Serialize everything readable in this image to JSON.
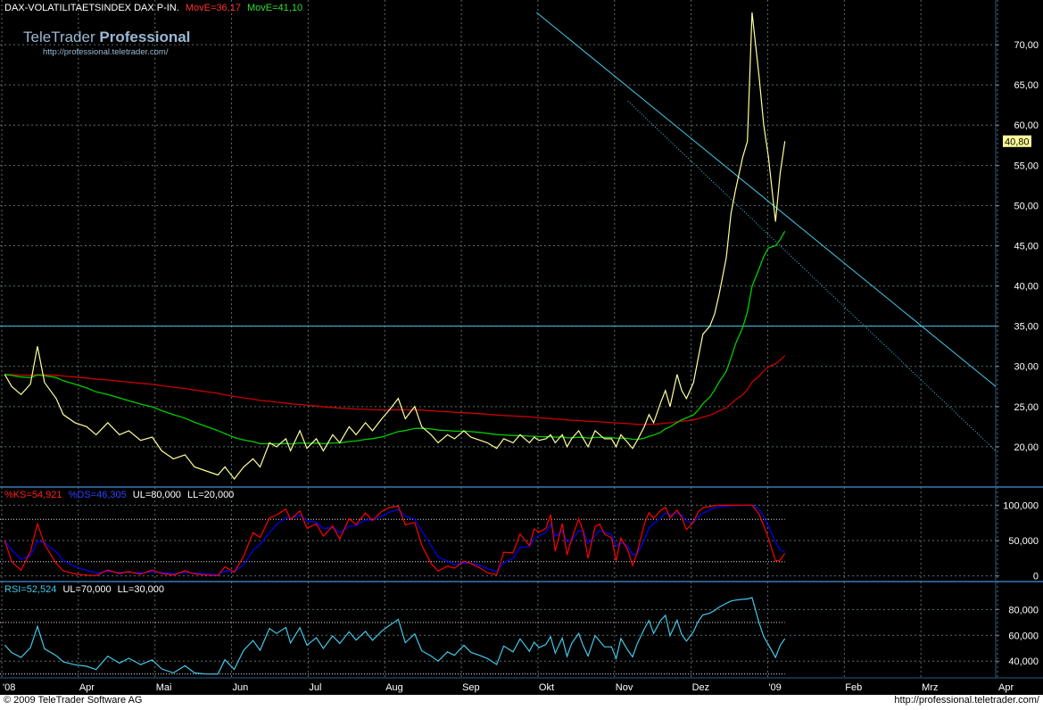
{
  "header": {
    "title": "DAX-VOLATILITAETSINDEX DAX P-IN.",
    "ma_short_label": "MovE=36,17",
    "ma_long_label": "MovE=41,10"
  },
  "watermark": {
    "brand_plain": "TeleTrader ",
    "brand_bold": "Professional",
    "url": "http://professional.teletrader.com/"
  },
  "footer": {
    "copyright": "© 2009 TeleTrader Software AG",
    "url": "http://professional.teletrader.com/"
  },
  "colors": {
    "background": "#000000",
    "price": "#ffff99",
    "ma_long": "#00cc00",
    "ma_short": "#cc0000",
    "trendline": "#44c8e8",
    "stoch_k": "#ff0000",
    "stoch_d": "#0000ff",
    "rsi": "#44c8e8",
    "grid": "#5a6e6e"
  },
  "x_axis": {
    "labels": [
      "'08",
      "Apr",
      "Mai",
      "Jun",
      "Jul",
      "Aug",
      "Sep",
      "Okt",
      "Nov",
      "Dez",
      "'09",
      "Feb",
      "Mrz",
      "Apr"
    ]
  },
  "chart_data": [
    {
      "type": "line",
      "name_text": "DAX-VOLATILITAETSINDEX DAX P-IN.",
      "x_start": "2008-03-01",
      "x_end": "2009-04-30",
      "ylim": [
        15,
        74
      ],
      "yticks": [
        "20,00",
        "25,00",
        "30,00",
        "35,00",
        "40,00",
        "45,00",
        "50,00",
        "55,00",
        "60,00",
        "65,00",
        "70,00"
      ],
      "ytick_values": [
        20,
        25,
        30,
        35,
        40,
        45,
        50,
        55,
        60,
        65,
        70
      ],
      "last_value": "40,80",
      "horizontal_line": 35,
      "trendlines": [
        {
          "style": "solid",
          "from": [
            "2008-10-16",
            74
          ],
          "to": [
            "2009-04-30",
            27.5
          ]
        },
        {
          "style": "dotted",
          "from": [
            "2008-11-24",
            63
          ],
          "to": [
            "2009-04-30",
            19.5
          ]
        }
      ],
      "series": [
        {
          "name": "DAX-VOLATILITAETSINDEX DAX P-IN.",
          "key": "price",
          "points": [
            [
              "2008-03-03",
              29
            ],
            [
              "2008-03-06",
              27.5
            ],
            [
              "2008-03-10",
              26.5
            ],
            [
              "2008-03-14",
              27.8
            ],
            [
              "2008-03-17",
              32.5
            ],
            [
              "2008-03-20",
              28
            ],
            [
              "2008-03-25",
              26
            ],
            [
              "2008-03-28",
              24
            ],
            [
              "2008-04-02",
              23
            ],
            [
              "2008-04-07",
              22.5
            ],
            [
              "2008-04-11",
              21.5
            ],
            [
              "2008-04-16",
              23
            ],
            [
              "2008-04-21",
              21.5
            ],
            [
              "2008-04-25",
              22
            ],
            [
              "2008-04-30",
              20.8
            ],
            [
              "2008-05-05",
              21.2
            ],
            [
              "2008-05-09",
              19.5
            ],
            [
              "2008-05-14",
              18.5
            ],
            [
              "2008-05-19",
              19
            ],
            [
              "2008-05-23",
              17.5
            ],
            [
              "2008-05-28",
              17
            ],
            [
              "2008-06-02",
              16.5
            ],
            [
              "2008-06-05",
              17.5
            ],
            [
              "2008-06-09",
              16
            ],
            [
              "2008-06-13",
              17.5
            ],
            [
              "2008-06-17",
              18.5
            ],
            [
              "2008-06-20",
              17.5
            ],
            [
              "2008-06-24",
              20.5
            ],
            [
              "2008-06-27",
              20
            ],
            [
              "2008-07-01",
              21
            ],
            [
              "2008-07-03",
              19.5
            ],
            [
              "2008-07-07",
              22
            ],
            [
              "2008-07-10",
              19.8
            ],
            [
              "2008-07-14",
              21
            ],
            [
              "2008-07-17",
              19.5
            ],
            [
              "2008-07-21",
              21.5
            ],
            [
              "2008-07-24",
              20.5
            ],
            [
              "2008-07-28",
              22.5
            ],
            [
              "2008-07-31",
              21.5
            ],
            [
              "2008-08-04",
              23
            ],
            [
              "2008-08-07",
              22
            ],
            [
              "2008-08-11",
              23.5
            ],
            [
              "2008-08-14",
              24.5
            ],
            [
              "2008-08-18",
              26
            ],
            [
              "2008-08-21",
              23.5
            ],
            [
              "2008-08-25",
              25
            ],
            [
              "2008-08-28",
              22.5
            ],
            [
              "2008-09-01",
              21.5
            ],
            [
              "2008-09-04",
              20.5
            ],
            [
              "2008-09-08",
              21.5
            ],
            [
              "2008-09-11",
              21
            ],
            [
              "2008-09-15",
              22
            ],
            [
              "2008-09-18",
              21.2
            ],
            [
              "2008-09-22",
              20.8
            ],
            [
              "2008-09-25",
              20.5
            ],
            [
              "2008-09-29",
              19.8
            ],
            [
              "2008-10-02",
              21
            ],
            [
              "2008-10-06",
              20.5
            ],
            [
              "2008-10-09",
              21.5
            ],
            [
              "2008-10-13",
              20.5
            ],
            [
              "2008-10-15",
              21.2
            ],
            [
              "2008-10-17",
              20.8
            ],
            [
              "2008-10-20",
              21
            ],
            [
              "2008-10-22",
              21.5
            ],
            [
              "2008-10-24",
              20.5
            ],
            [
              "2008-10-27",
              21.5
            ],
            [
              "2008-10-29",
              20
            ],
            [
              "2008-10-31",
              21
            ],
            [
              "2008-11-03",
              22
            ],
            [
              "2008-11-05",
              21
            ],
            [
              "2008-11-07",
              20
            ],
            [
              "2008-11-10",
              22
            ],
            [
              "2008-11-12",
              21.5
            ],
            [
              "2008-11-14",
              21
            ],
            [
              "2008-11-17",
              21
            ],
            [
              "2008-11-19",
              20
            ],
            [
              "2008-11-21",
              21.5
            ],
            [
              "2008-11-24",
              20.5
            ],
            [
              "2008-11-26",
              19.8
            ],
            [
              "2008-11-28",
              20.8
            ],
            [
              "2008-12-01",
              22.5
            ],
            [
              "2008-12-03",
              24
            ],
            [
              "2008-12-05",
              23
            ],
            [
              "2008-12-08",
              25.5
            ],
            [
              "2008-12-10",
              27
            ],
            [
              "2008-12-12",
              25
            ],
            [
              "2008-12-15",
              29
            ],
            [
              "2008-12-17",
              27
            ],
            [
              "2008-12-19",
              26
            ],
            [
              "2008-12-22",
              28
            ],
            [
              "2008-12-24",
              31
            ],
            [
              "2008-12-26",
              34
            ],
            [
              "2008-12-29",
              35
            ],
            [
              "2008-12-31",
              36.5
            ],
            [
              "2009-01-02",
              39
            ],
            [
              "2009-01-05",
              43.5
            ],
            [
              "2009-01-07",
              49
            ],
            [
              "2009-01-09",
              52
            ],
            [
              "2009-01-12",
              56
            ],
            [
              "2009-01-14",
              58
            ],
            [
              "2009-01-16",
              74
            ],
            [
              "2009-01-19",
              66
            ],
            [
              "2009-01-21",
              60
            ],
            [
              "2009-01-23",
              56
            ],
            [
              "2009-01-26",
              48
            ],
            [
              "2009-01-28",
              54
            ],
            [
              "2009-01-30",
              58
            ]
          ]
        },
        {
          "name": "MovE=41,10",
          "key": "ma_long"
        },
        {
          "name": "MovE=36,17",
          "key": "ma_short"
        }
      ]
    },
    {
      "type": "line",
      "label_k": "%KS=54,921",
      "label_d": "%DS=46,305",
      "label_ul": "UL=80,000",
      "label_ll": "LL=20,000",
      "ylim": [
        -8,
        108
      ],
      "yticks": [
        "0",
        "50,000",
        "100,000"
      ],
      "ytick_values": [
        0,
        50,
        100
      ],
      "levels": [
        80,
        20
      ]
    },
    {
      "type": "line",
      "label_rsi": "RSI=52,524",
      "label_ul": "UL=70,000",
      "label_ll": "LL=30,000",
      "ylim": [
        27,
        92
      ],
      "yticks": [
        "40,000",
        "60,000",
        "80,000"
      ],
      "ytick_values": [
        40,
        60,
        80
      ],
      "levels": [
        70,
        30
      ]
    }
  ]
}
